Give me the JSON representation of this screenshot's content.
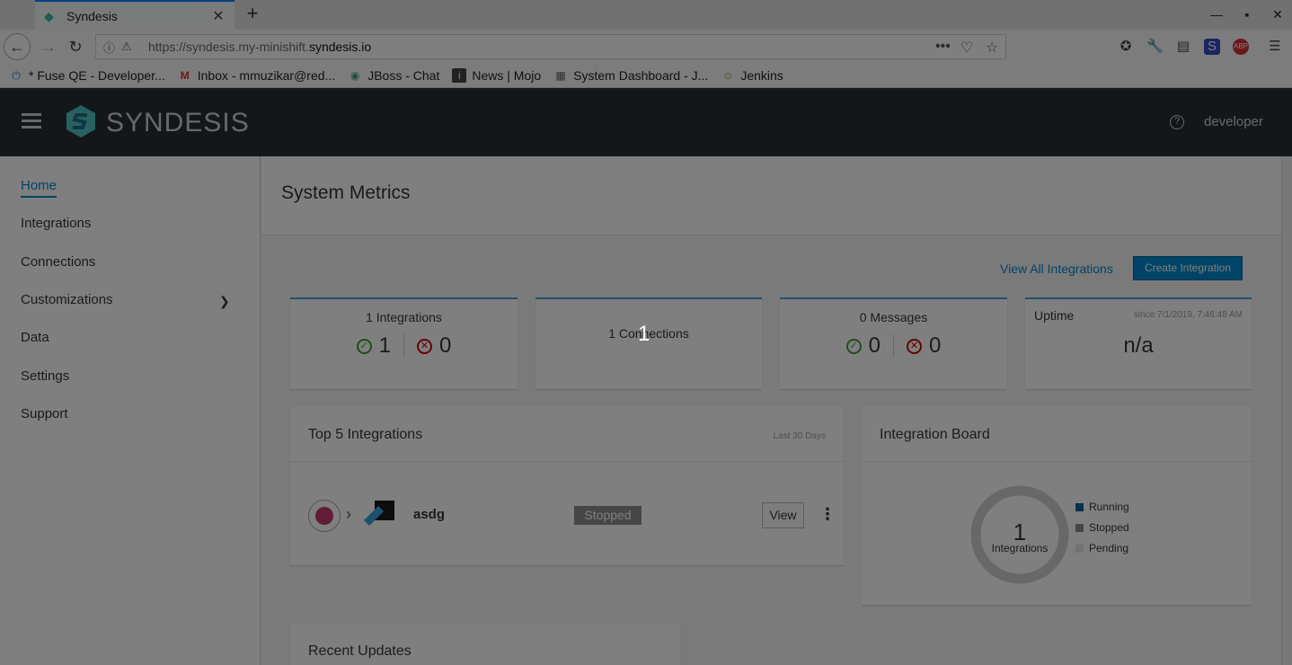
{
  "browser": {
    "tab_title": "Syndesis",
    "url_prefix": "https://syndesis.my-minishift.",
    "url_domain": "syndesis.io",
    "bookmarks": [
      {
        "label": "* Fuse QE - Developer...",
        "icon": "fuse-icon",
        "color": "#2a7bd4"
      },
      {
        "label": "Inbox - mmuzikar@red...",
        "icon": "gmail-icon",
        "color": "#d93025"
      },
      {
        "label": "JBoss - Chat",
        "icon": "chat-icon",
        "color": "#3a9d6e"
      },
      {
        "label": "News | Mojo",
        "icon": "news-icon",
        "color": "#555555"
      },
      {
        "label": "System Dashboard - J...",
        "icon": "dashboard-icon",
        "color": "#666666"
      },
      {
        "label": "Jenkins",
        "icon": "jenkins-icon",
        "color": "#b5945b"
      }
    ]
  },
  "header": {
    "logo_text": "SYNDESIS",
    "user": "developer"
  },
  "sidebar": {
    "items": [
      {
        "label": "Home"
      },
      {
        "label": "Integrations"
      },
      {
        "label": "Connections"
      },
      {
        "label": "Customizations"
      },
      {
        "label": "Data"
      },
      {
        "label": "Settings"
      },
      {
        "label": "Support"
      }
    ]
  },
  "main": {
    "page_title": "System Metrics",
    "view_all_link": "View All Integrations",
    "create_button": "Create Integration",
    "metrics": {
      "integrations": {
        "label": "1 Integrations",
        "ok": "1",
        "err": "0"
      },
      "connections": {
        "label": "1 Connections"
      },
      "messages": {
        "label": "0 Messages",
        "ok": "0",
        "err": "0"
      },
      "uptime": {
        "label": "Uptime",
        "since": "since 7/1/2019, 7:46:48 AM",
        "value": "n/a"
      }
    },
    "top_integrations": {
      "title": "Top 5 Integrations",
      "subtitle": "Last 30 Days",
      "rows": [
        {
          "name": "asdg",
          "status": "Stopped",
          "view_label": "View"
        }
      ]
    },
    "board": {
      "title": "Integration Board",
      "count": "1",
      "count_label": "Integrations",
      "legend": [
        {
          "label": "Running",
          "color": "#00659c"
        },
        {
          "label": "Stopped",
          "color": "#8b8d8f"
        },
        {
          "label": "Pending",
          "color": "#d1d1d1"
        }
      ]
    },
    "recent": {
      "title": "Recent Updates"
    }
  },
  "overlay": {
    "step_number": "1"
  },
  "colors": {
    "accent": "#0088ce",
    "header_bg": "#292e34",
    "ok": "#3f9c35",
    "error": "#cc0000"
  }
}
